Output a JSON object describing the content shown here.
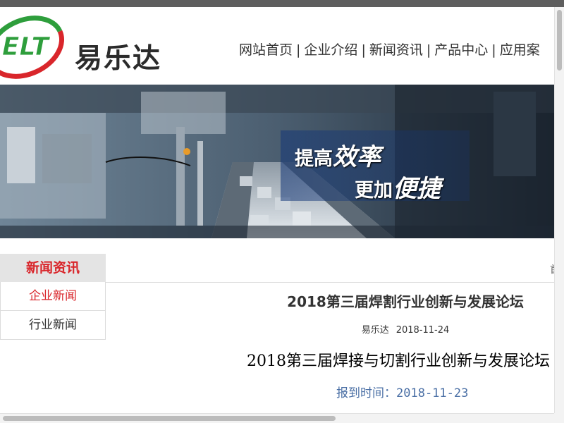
{
  "brand": {
    "logo_text": "ELT",
    "name": "易乐达"
  },
  "nav": {
    "items": [
      "网站首页",
      "企业介绍",
      "新闻资讯",
      "产品中心",
      "应用案"
    ],
    "separator": "|"
  },
  "banner": {
    "slogan_line1_a": "提高",
    "slogan_line1_b": "效率",
    "slogan_line2_a": "更加",
    "slogan_line2_b": "便捷"
  },
  "sidebar": {
    "title": "新闻资讯",
    "items": [
      {
        "label": "企业新闻",
        "active": true
      },
      {
        "label": "行业新闻",
        "active": false
      }
    ]
  },
  "breadcrumb": {
    "glyph": "首"
  },
  "article": {
    "title": "2018第三届焊割行业创新与发展论坛",
    "author": "易乐达",
    "date": "2018-11-24",
    "body_heading": "2018第三届焊接与切割行业创新与发展论坛",
    "report_label": "报到时间：",
    "report_date": "2018-11-23"
  },
  "colors": {
    "accent_red": "#d9262b",
    "logo_green": "#2e9e3c",
    "link_blue": "#4a6fa5"
  }
}
